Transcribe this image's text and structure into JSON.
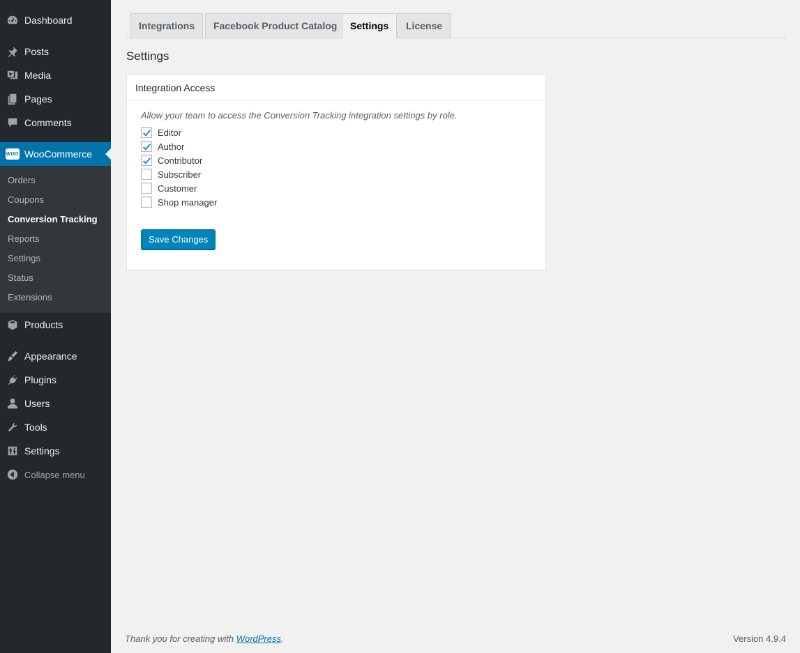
{
  "sidebar": {
    "items": [
      {
        "id": "dashboard",
        "label": "Dashboard",
        "icon": "dashboard-icon"
      },
      {
        "id": "posts",
        "label": "Posts",
        "icon": "pin-icon"
      },
      {
        "id": "media",
        "label": "Media",
        "icon": "media-icon"
      },
      {
        "id": "pages",
        "label": "Pages",
        "icon": "pages-icon"
      },
      {
        "id": "comments",
        "label": "Comments",
        "icon": "comment-icon"
      },
      {
        "id": "woocommerce",
        "label": "WooCommerce",
        "icon": "woo-icon",
        "badge": "WOO"
      },
      {
        "id": "products",
        "label": "Products",
        "icon": "box-icon"
      },
      {
        "id": "appearance",
        "label": "Appearance",
        "icon": "brush-icon"
      },
      {
        "id": "plugins",
        "label": "Plugins",
        "icon": "plug-icon"
      },
      {
        "id": "users",
        "label": "Users",
        "icon": "user-icon"
      },
      {
        "id": "tools",
        "label": "Tools",
        "icon": "wrench-icon"
      },
      {
        "id": "settings",
        "label": "Settings",
        "icon": "sliders-icon"
      }
    ],
    "submenu": [
      "Orders",
      "Coupons",
      "Conversion Tracking",
      "Reports",
      "Settings",
      "Status",
      "Extensions"
    ],
    "collapse_label": "Collapse menu"
  },
  "tabs": [
    "Integrations",
    "Facebook Product Catalog",
    "Settings",
    "License"
  ],
  "active_tab": "Settings",
  "page_title": "Settings",
  "panel": {
    "title": "Integration Access",
    "description": "Allow your team to access the Conversion Tracking integration settings by role.",
    "roles": [
      {
        "label": "Editor",
        "checked": true
      },
      {
        "label": "Author",
        "checked": true
      },
      {
        "label": "Contributor",
        "checked": true
      },
      {
        "label": "Subscriber",
        "checked": false
      },
      {
        "label": "Customer",
        "checked": false
      },
      {
        "label": "Shop manager",
        "checked": false
      }
    ],
    "save_label": "Save Changes"
  },
  "footer": {
    "thanks_prefix": "Thank you for creating with ",
    "thanks_link": "WordPress",
    "thanks_suffix": ".",
    "version": "Version 4.9.4"
  },
  "colors": {
    "sidebar_bg": "#23282d",
    "submenu_bg": "#32373c",
    "accent": "#0073aa",
    "button": "#0085ba",
    "background": "#f1f1f1"
  }
}
